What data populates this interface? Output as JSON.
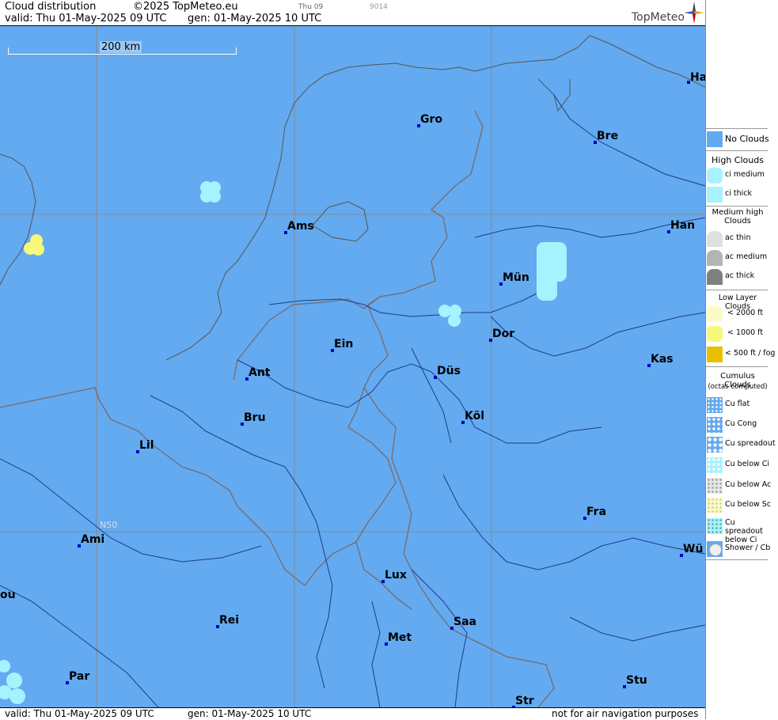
{
  "header": {
    "title": "Cloud distribution",
    "copyright": "©2025 TopMeteo.eu",
    "valid": "valid:  Thu  01-May-2025  09 UTC",
    "generated": "gen: 01-May-2025 10 UTC",
    "small1": "Thu 09",
    "small2": "9014",
    "brand": "TopMeteo"
  },
  "map": {
    "scale_label": "200 km",
    "lat_label": "N50",
    "background_color": "#63aaf0",
    "cities": [
      "Ha",
      "Gro",
      "Bre",
      "Ams",
      "Han",
      "Mün",
      "Dor",
      "Ein",
      "Kas",
      "Düs",
      "Ant",
      "Köl",
      "Bru",
      "Lil",
      "Fra",
      "Ami",
      "Wü",
      "Lux",
      "Saa",
      "Met",
      "ou",
      "Rei",
      "Par",
      "Stu",
      "Str"
    ]
  },
  "footer": {
    "valid": "valid:  Thu  01-May-2025  09 UTC",
    "generated": "gen: 01-May-2025 10 UTC",
    "disclaimer": "not for air navigation purposes"
  },
  "legend": {
    "no_clouds": "No Clouds",
    "high_clouds": "High Clouds",
    "ci_medium": "ci medium",
    "ci_thick": "ci thick",
    "medium_high_clouds": "Medium high Clouds",
    "ac_thin": "ac thin",
    "ac_medium": "ac medium",
    "ac_thick": "ac thick",
    "low_layer_clouds": "Low Layer Clouds",
    "low_2000": "< 2000 ft",
    "low_1000": "< 1000 ft",
    "low_500": "< 500 ft / fog",
    "cumulus_clouds": "Cumulus Clouds",
    "octas": "(octas computed)",
    "cu_flat": "Cu flat",
    "cu_cong": "Cu Cong",
    "cu_spreadout": "Cu spreadout",
    "cu_below_ci": "Cu below Ci",
    "cu_below_ac": "Cu below Ac",
    "cu_below_sc": "Cu below Sc",
    "cu_spreadout_below_ci": "Cu spreadout below Ci",
    "shower_cb": "Shower / Cb"
  },
  "colors": {
    "no_clouds": "#63aaf0",
    "ci": "#a6f2ff",
    "low_2000": "#fbfbc4",
    "low_1000": "#f7f77a",
    "low_500": "#e8c000",
    "ac_thin": "#e0e0e0",
    "ac_medium": "#b4b4b4",
    "ac_thick": "#808080",
    "city_dot": "#0000c0"
  }
}
